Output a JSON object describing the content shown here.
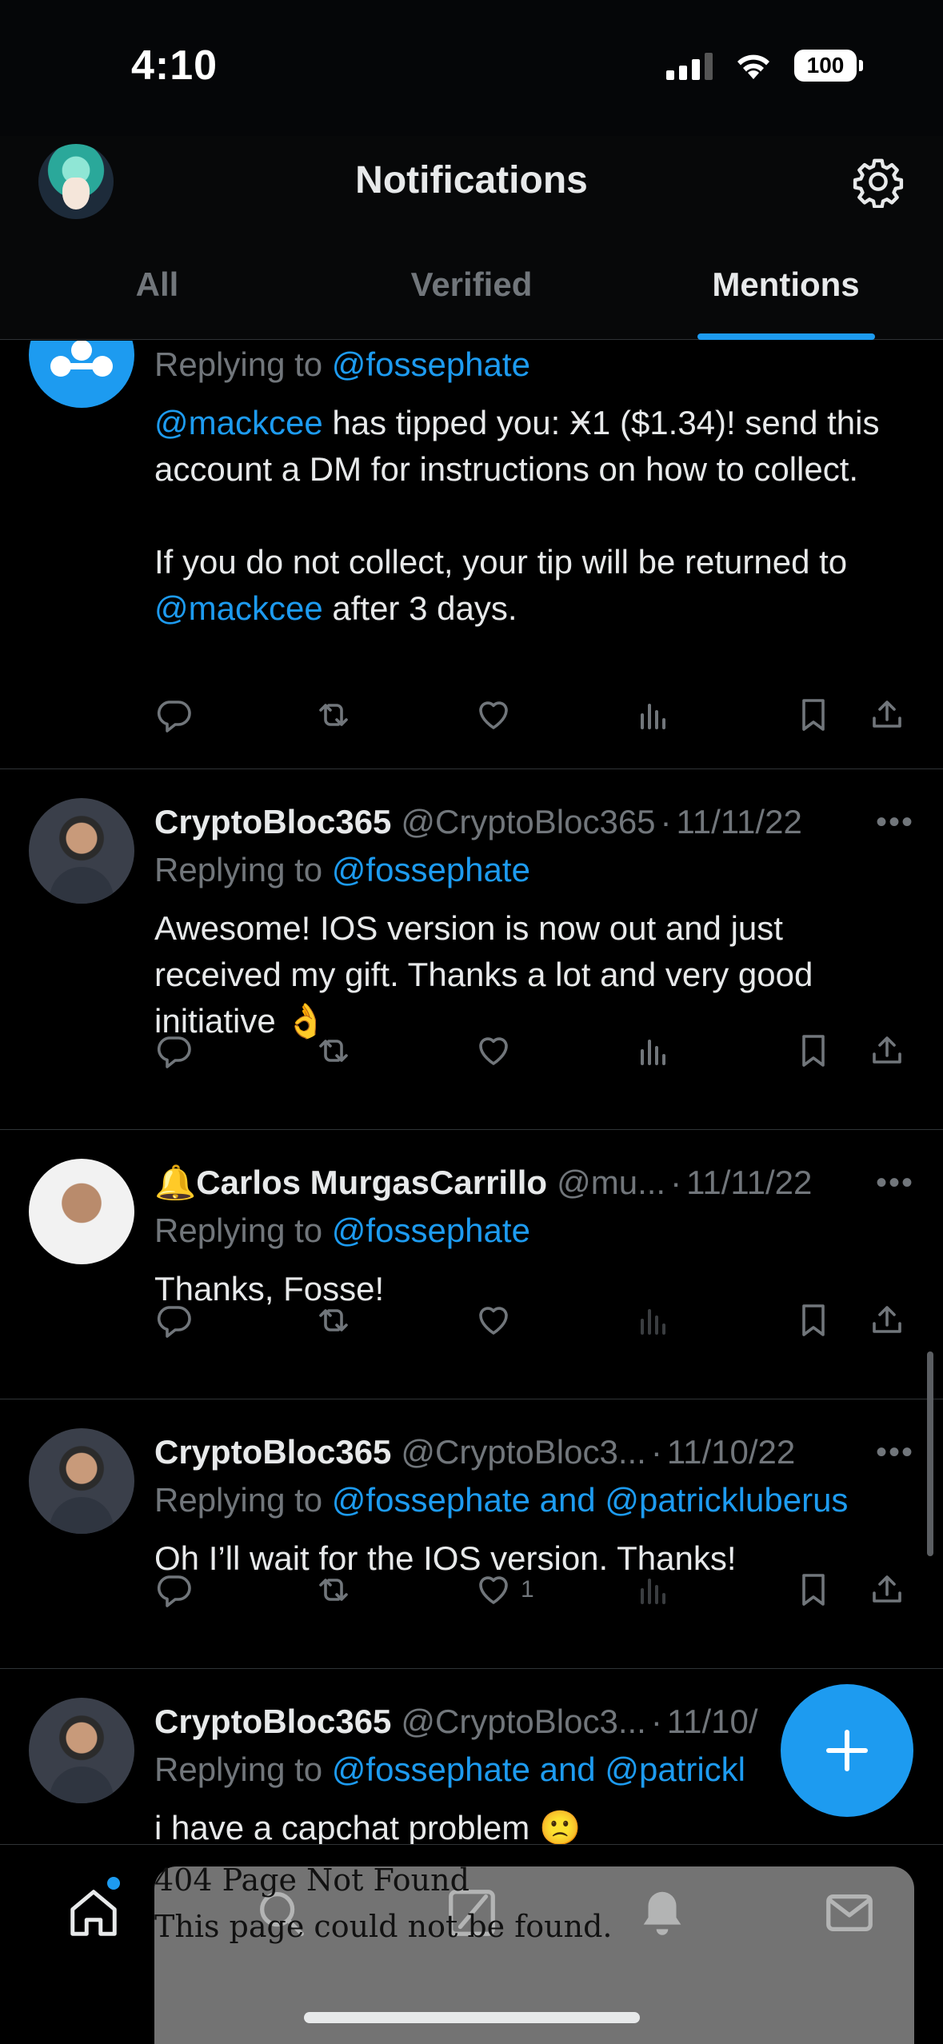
{
  "status_bar": {
    "time": "4:10",
    "battery": "100"
  },
  "header": {
    "title": "Notifications",
    "tabs": [
      {
        "label": "All"
      },
      {
        "label": "Verified"
      },
      {
        "label": "Mentions"
      }
    ],
    "active_tab": "Mentions"
  },
  "tweets": [
    {
      "reply_prefix": "Replying to",
      "reply_to": "@fossephate",
      "text_mention1": "@mackcee",
      "text_part1": " has tipped you: Ӿ1 ($1.34)!  send this account a DM for instructions on how to collect.",
      "text_part2": "If you do not collect, your tip will be returned to ",
      "text_mention2": "@mackcee",
      "text_part3": " after 3 days."
    },
    {
      "name": "CryptoBloc365",
      "handle": "@CryptoBloc365",
      "date": "11/11/22",
      "reply_prefix": "Replying to",
      "reply_to": "@fossephate",
      "text": "Awesome! IOS version is now out and just received my gift. Thanks a lot and very good initiative 👌"
    },
    {
      "name": "🔔Carlos MurgasCarrillo",
      "handle": "@mu...",
      "date": "11/11/22",
      "reply_prefix": "Replying to",
      "reply_to": "@fossephate",
      "text": "Thanks, Fosse!"
    },
    {
      "name": "CryptoBloc365",
      "handle": "@CryptoBloc3...",
      "date": "11/10/22",
      "reply_prefix": "Replying to",
      "reply_to": "@fossephate and @patrickluberus",
      "text": "Oh I’ll wait for the IOS version. Thanks!",
      "like_count": "1"
    },
    {
      "name": "CryptoBloc365",
      "handle": "@CryptoBloc3...",
      "date": "11/10/",
      "reply_prefix": "Replying to",
      "reply_to": "@fossephate and @patrickl",
      "text": "i have a capchat problem 🙁"
    }
  ],
  "overlay": {
    "line1": "404 Page Not Found",
    "line2": "This page could not be found."
  },
  "colors": {
    "accent": "#1d9bf0",
    "background": "#000000",
    "muted": "#71767b"
  },
  "icons": [
    "signal-icon",
    "wifi-icon",
    "battery-icon",
    "gear-icon",
    "reply-icon",
    "retweet-icon",
    "like-icon",
    "views-icon",
    "bookmark-icon",
    "share-icon",
    "home-icon",
    "search-icon",
    "grok-icon",
    "bell-icon",
    "mail-icon",
    "compose-icon"
  ]
}
